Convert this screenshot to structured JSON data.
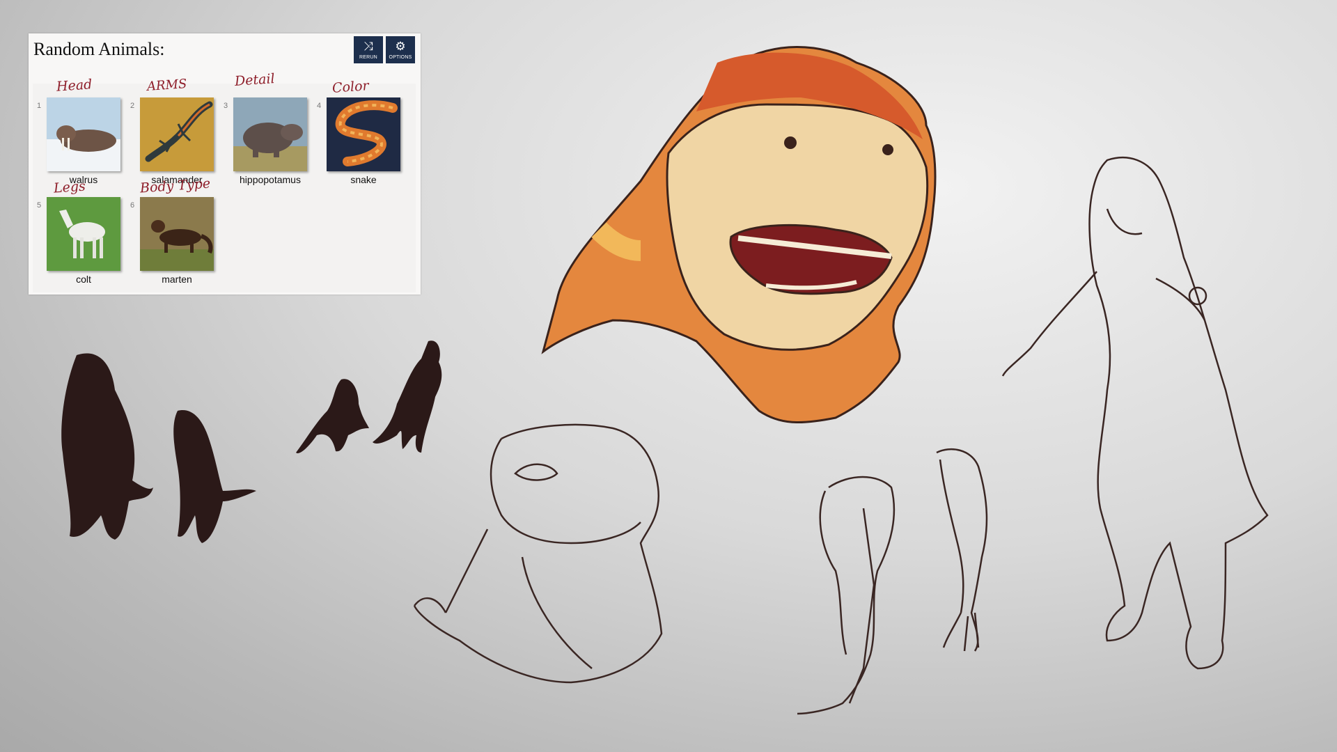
{
  "panel": {
    "title": "Random Animals:",
    "buttons": {
      "rerun": {
        "label": "RERUN",
        "icon": "shuffle-icon"
      },
      "options": {
        "label": "OPTIONS",
        "icon": "gear-icon"
      }
    },
    "button_color": "#1d2f4d",
    "animals": [
      {
        "num": "1",
        "name": "walrus",
        "tag": "Head"
      },
      {
        "num": "2",
        "name": "salamander",
        "tag": "ARMS"
      },
      {
        "num": "3",
        "name": "hippopotamus",
        "tag": "Detail"
      },
      {
        "num": "4",
        "name": "snake",
        "tag": "Color"
      },
      {
        "num": "5",
        "name": "colt",
        "tag": "Legs"
      },
      {
        "num": "6",
        "name": "marten",
        "tag": "Body Type"
      }
    ]
  },
  "colors": {
    "annotation": "#8e1e2a",
    "silhouette": "#2b1918",
    "creature_orange": "#e4873e",
    "creature_cream": "#f0d5a4"
  }
}
